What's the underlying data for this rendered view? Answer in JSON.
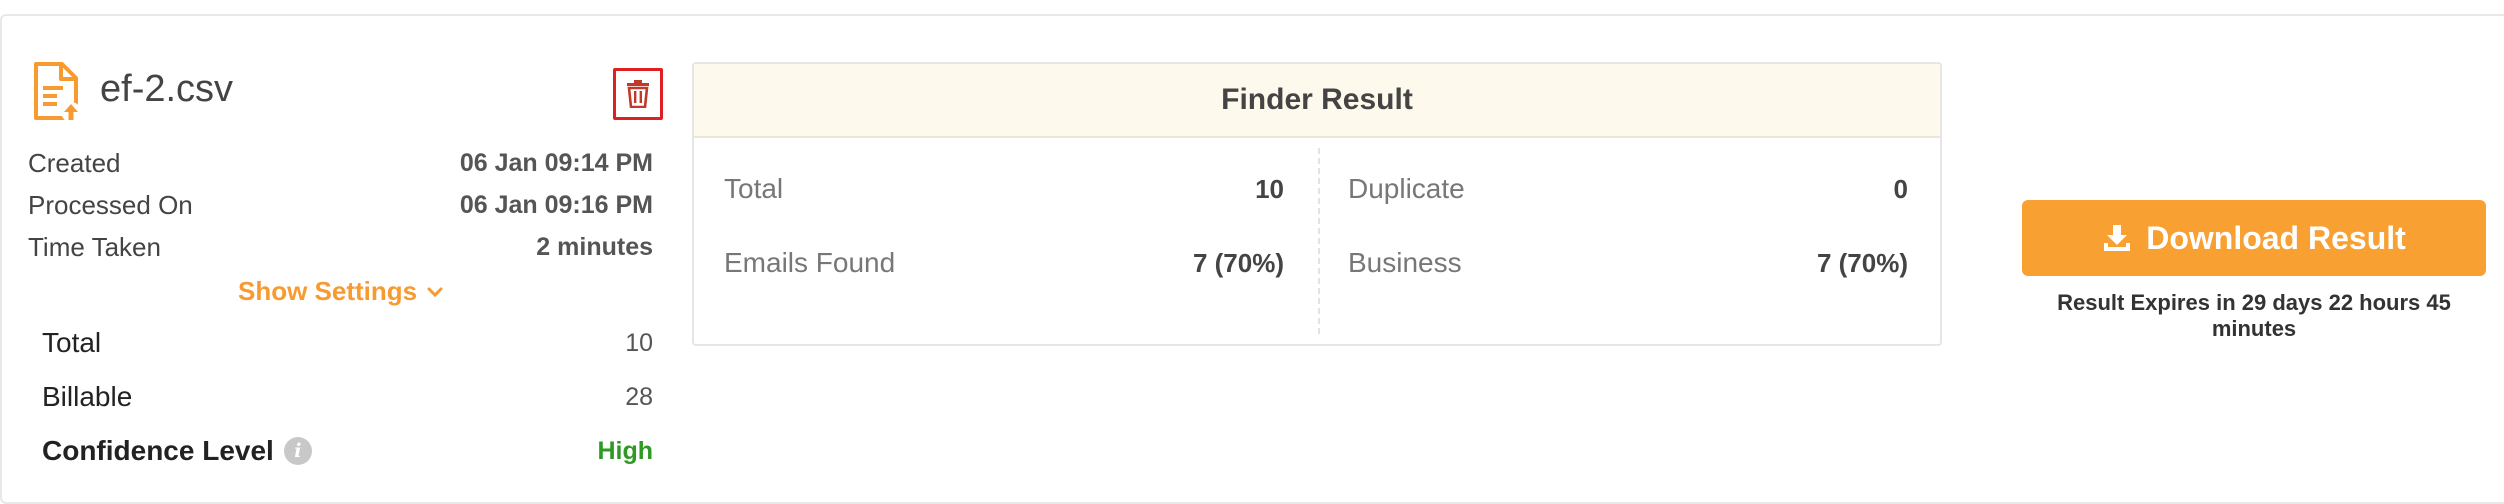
{
  "file": {
    "name": "ef-2.csv",
    "icon": "file-upload-icon",
    "delete_icon": "trash-icon"
  },
  "meta": [
    {
      "label": "Created",
      "value": "06 Jan 09:14 PM"
    },
    {
      "label": "Processed On",
      "value": "06 Jan 09:16 PM"
    },
    {
      "label": "Time Taken",
      "value": "2 minutes"
    }
  ],
  "settings": {
    "label": "Show Settings",
    "icon": "chevron-down-icon"
  },
  "stats": {
    "total_label": "Total",
    "total_value": "10",
    "billable_label": "Billable",
    "billable_value": "28",
    "confidence_label": "Confidence Level",
    "confidence_value": "High",
    "info_icon_glyph": "i"
  },
  "finder": {
    "title": "Finder Result",
    "left": [
      {
        "label": "Total",
        "value": "10"
      },
      {
        "label": "Emails Found",
        "value": "7 (70%)"
      }
    ],
    "right": [
      {
        "label": "Duplicate",
        "value": "0"
      },
      {
        "label": "Business",
        "value": "7 (70%)"
      }
    ]
  },
  "download": {
    "label": "Download Result",
    "icon": "download-icon",
    "expires": "Result Expires in 29 days 22 hours 45 minutes"
  },
  "colors": {
    "accent": "#f9a033",
    "danger": "#e02020",
    "success": "#2e9a23",
    "header_bg": "#fdf9ec"
  }
}
